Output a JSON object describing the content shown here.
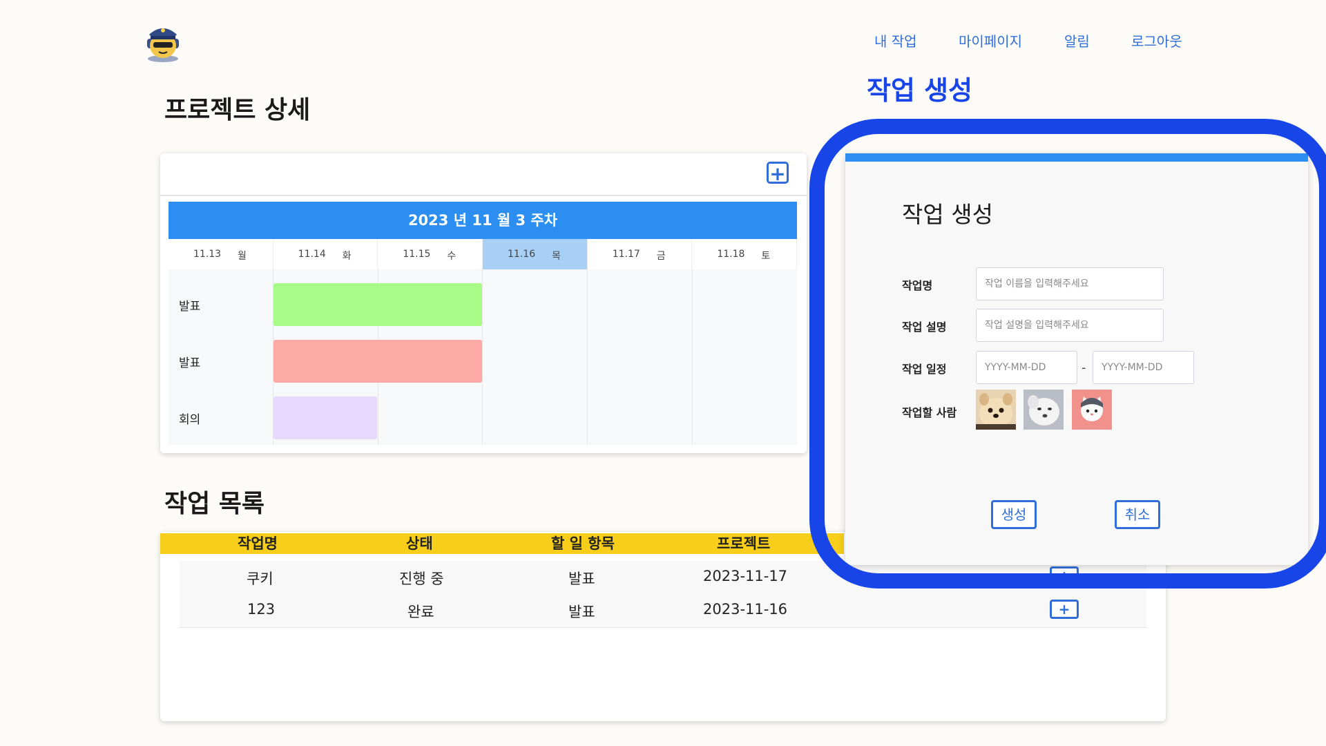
{
  "nav": {
    "my_tasks": "내 작업",
    "my_page": "마이페이지",
    "notifications": "알림",
    "logout": "로그아웃"
  },
  "page_title": "프로젝트 상세",
  "annotation_title": "작업 생성",
  "calendar": {
    "header": "2023 년 11 월 3 주차",
    "days": [
      {
        "date": "11.13",
        "weekday": "월"
      },
      {
        "date": "11.14",
        "weekday": "화"
      },
      {
        "date": "11.15",
        "weekday": "수"
      },
      {
        "date": "11.16",
        "weekday": "목"
      },
      {
        "date": "11.17",
        "weekday": "금"
      },
      {
        "date": "11.18",
        "weekday": "토"
      }
    ],
    "active_day": "11.16",
    "rows": [
      {
        "label": "발표",
        "color": "#a8fb87",
        "start": "11.14",
        "end": "11.15"
      },
      {
        "label": "발표",
        "color": "#fda9a6",
        "start": "11.14",
        "end": "11.15"
      },
      {
        "label": "회의",
        "color": "#e7d8fd",
        "start": "11.14",
        "end": "11.14"
      }
    ],
    "add_icon": "plus-square-icon"
  },
  "task_list": {
    "title": "작업 목록",
    "columns": [
      "작업명",
      "상태",
      "할 일 항목",
      "프로젝트"
    ],
    "rows": [
      {
        "name": "쿠키",
        "status": "진행 중",
        "todo": "발표",
        "date": "2023-11-17",
        "action": "+"
      },
      {
        "name": "123",
        "status": "완료",
        "todo": "발표",
        "date": "2023-11-16",
        "action": "+"
      }
    ]
  },
  "modal": {
    "title": "작업 생성",
    "fields": {
      "name_label": "작업명",
      "name_placeholder": "작업 이름을 입력해주세요",
      "desc_label": "작업 설명",
      "desc_placeholder": "작업 설명을 입력해주세요",
      "schedule_label": "작업 일정",
      "start_placeholder": "YYYY-MM-DD",
      "separator": "-",
      "end_placeholder": "YYYY-MM-DD",
      "assignee_label": "작업할 사람"
    },
    "assignees": [
      "pomeranian-avatar",
      "white-dog-avatar",
      "cat-avatar"
    ],
    "create_button": "생성",
    "cancel_button": "취소"
  },
  "colors": {
    "accent_blue": "#2b8ef0",
    "link_blue": "#2f6ed8",
    "highlight_ring": "#1745e8",
    "table_header": "#f7cf1a"
  }
}
